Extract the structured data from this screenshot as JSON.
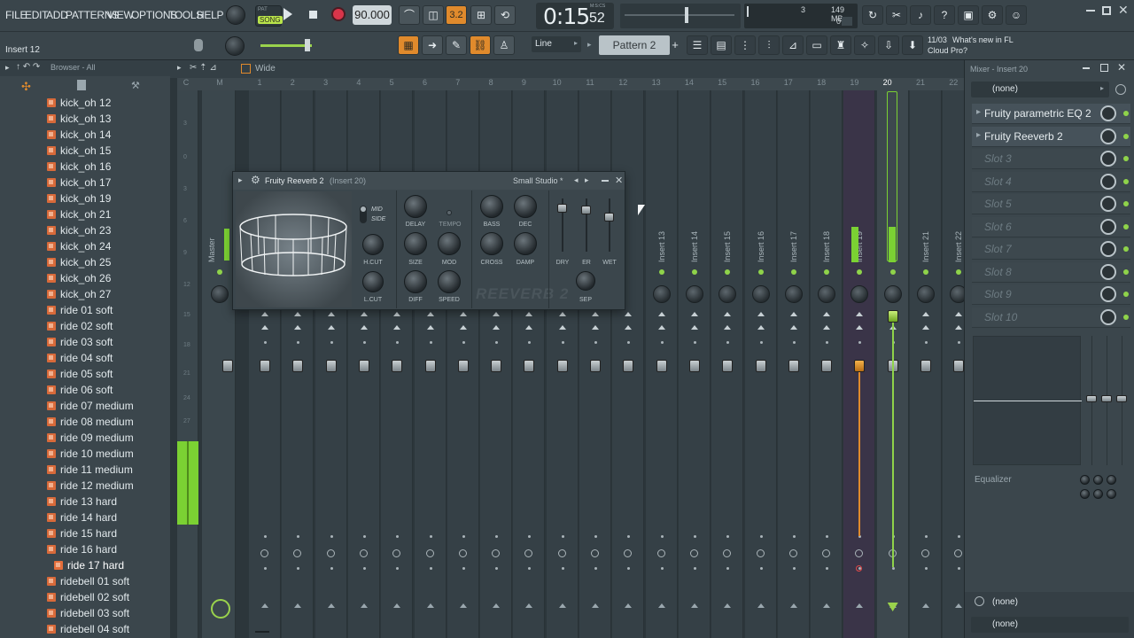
{
  "menu": [
    "FILE",
    "EDIT",
    "ADD",
    "PATTERNS",
    "VIEW",
    "OPTIONS",
    "TOOLS",
    "HELP"
  ],
  "hint_bar": "Insert 12",
  "transport": {
    "song_label": "SONG",
    "pat_label": "PAT",
    "tempo": "90.000",
    "time_main": "0:15",
    "time_sub": "52",
    "time_unit": "M:S:CS",
    "snap_value": "3.2",
    "mem": "149 MB",
    "cpu_top": "3",
    "cpu_bottom": "0"
  },
  "toolbar": {
    "snap_label": "Line",
    "pattern": "Pattern 2",
    "news_date": "11/03",
    "news_line1": "What's new in FL",
    "news_line2": "Cloud Pro?"
  },
  "browser": {
    "title": "Browser - All",
    "items": [
      "kick_oh 12",
      "kick_oh 13",
      "kick_oh 14",
      "kick_oh 15",
      "kick_oh 16",
      "kick_oh 17",
      "kick_oh 19",
      "kick_oh 21",
      "kick_oh 23",
      "kick_oh 24",
      "kick_oh 25",
      "kick_oh 26",
      "kick_oh 27",
      "ride 01 soft",
      "ride 02 soft",
      "ride 03 soft",
      "ride 04 soft",
      "ride 05 soft",
      "ride 06 soft",
      "ride 07 medium",
      "ride 08 medium",
      "ride 09 medium",
      "ride 10 medium",
      "ride 11 medium",
      "ride 12 medium",
      "ride 13 hard",
      "ride 14 hard",
      "ride 15 hard",
      "ride 16 hard",
      "ride 17 hard",
      "ridebell 01 soft",
      "ridebell 02 soft",
      "ridebell 03 soft",
      "ridebell 04 soft"
    ],
    "selected_index": 29
  },
  "mixer": {
    "view_label": "Wide",
    "ruler": [
      "C",
      "M",
      "1",
      "2",
      "3",
      "4",
      "5",
      "6",
      "7",
      "8",
      "9",
      "10",
      "11",
      "12",
      "13",
      "14",
      "15",
      "16",
      "17",
      "18",
      "19",
      "20",
      "21",
      "22"
    ],
    "db_scale": [
      "3",
      "0",
      "3",
      "6",
      "9",
      "12",
      "15",
      "18",
      "21",
      "24",
      "27"
    ],
    "master_label": "Master",
    "visible_inserts": [
      "Insert 13",
      "Insert 14",
      "Insert 15",
      "Insert 16",
      "Insert 17",
      "Insert 18",
      "Insert 19",
      "Insert 20",
      "Insert 21",
      "Insert 22"
    ],
    "selected_insert": "20"
  },
  "plugin": {
    "title": "Fruity Reeverb 2",
    "subtitle": "(Insert 20)",
    "preset": "Small Studio *",
    "mode_top": "MID",
    "mode_bottom": "SIDE",
    "knobs": {
      "delay": "DELAY",
      "tempo": "TEMPO",
      "bass": "BASS",
      "dec": "DEC",
      "hcut": "H.CUT",
      "size": "SIZE",
      "mod": "MOD",
      "cross": "CROSS",
      "damp": "DAMP",
      "lcut": "L.CUT",
      "diff": "DIFF",
      "speed": "SPEED",
      "sep": "SEP"
    },
    "sliders": [
      "DRY",
      "ER",
      "WET"
    ],
    "logo": "REEVERB 2"
  },
  "effects_panel": {
    "title": "Mixer - Insert 20",
    "input": "(none)",
    "slots": [
      {
        "name": "Fruity parametric EQ 2",
        "filled": true
      },
      {
        "name": "Fruity Reeverb 2",
        "filled": true
      },
      {
        "name": "Slot 3",
        "filled": false
      },
      {
        "name": "Slot 4",
        "filled": false
      },
      {
        "name": "Slot 5",
        "filled": false
      },
      {
        "name": "Slot 6",
        "filled": false
      },
      {
        "name": "Slot 7",
        "filled": false
      },
      {
        "name": "Slot 8",
        "filled": false
      },
      {
        "name": "Slot 9",
        "filled": false
      },
      {
        "name": "Slot 10",
        "filled": false
      }
    ],
    "eq_label": "Equalizer",
    "output_1": "(none)",
    "output_2": "(none)"
  },
  "colors": {
    "accent_orange": "#e08a2c",
    "meter_green": "#8fd34a",
    "time_text": "#e8eef1"
  }
}
